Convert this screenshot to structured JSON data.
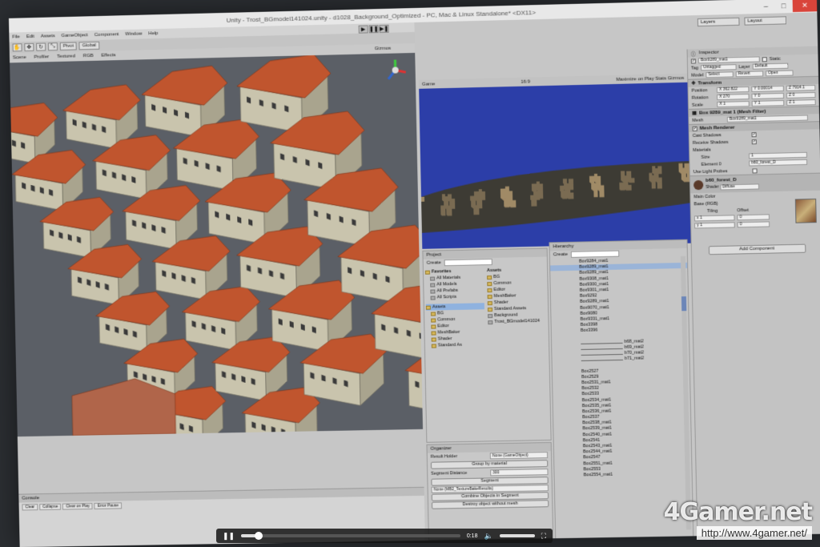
{
  "window": {
    "title": "Unity - Trost_BGmodel141024.unity - d1028_Background_Optimized - PC, Mac & Linux Standalone* <DX11>"
  },
  "menu": [
    "File",
    "Edit",
    "Assets",
    "GameObject",
    "Component",
    "Window",
    "Help"
  ],
  "toolbar": {
    "pivot_label": "Pivot",
    "global_label": "Global",
    "layers_label": "Layers",
    "layout_label": "Layout"
  },
  "scene": {
    "tabs": [
      "Scene",
      "Profiler"
    ],
    "shading": "Textured",
    "mode": "RGB",
    "effects": "Effects",
    "gizmos": "Gizmos"
  },
  "game": {
    "tab": "Game",
    "aspect": "16:9",
    "options": "Maximize on Play  Stats  Gizmos"
  },
  "project": {
    "tab": "Project",
    "create_label": "Create",
    "favorites_label": "Favorites",
    "favorites": [
      "All Materials",
      "All Models",
      "All Prefabs",
      "All Scripts"
    ],
    "assets_root": "Assets",
    "assets_tree": [
      "BG",
      "Common",
      "Editor",
      "MeshBaker",
      "Shader",
      "Standard As"
    ],
    "assets_header": "Assets",
    "assets_list": [
      "BG",
      "Common",
      "Editor",
      "MeshBaker",
      "Shader",
      "Standard Assets",
      "Background",
      "Trost_BGmodel141024"
    ]
  },
  "hierarchy": {
    "tab": "Hierarchy",
    "create_label": "Create",
    "rows": [
      {
        "label": "Box9284_mat1",
        "sel": false,
        "indent": false
      },
      {
        "label": "Box9289_mat1",
        "sel": true,
        "indent": false
      },
      {
        "label": "Box9289_mat1",
        "sel": false,
        "indent": false
      },
      {
        "label": "Box9308_mat1",
        "sel": false,
        "indent": false
      },
      {
        "label": "Box9300_mat1",
        "sel": false,
        "indent": false
      },
      {
        "label": "Box9301_mat1",
        "sel": false,
        "indent": false
      },
      {
        "label": "Box9292",
        "sel": false,
        "indent": false
      },
      {
        "label": "Box9289_mat1",
        "sel": false,
        "indent": false
      },
      {
        "label": "Box9070_mat1",
        "sel": false,
        "indent": false
      },
      {
        "label": "Box9080",
        "sel": false,
        "indent": false
      },
      {
        "label": "Box9331_mat1",
        "sel": false,
        "indent": false
      },
      {
        "label": "Box3398",
        "sel": false,
        "indent": false
      },
      {
        "label": "Box3396",
        "sel": false,
        "indent": false
      },
      {
        "label": "",
        "sel": false,
        "indent": false
      },
      {
        "label": "b68_mat2",
        "sel": false,
        "indent": true
      },
      {
        "label": "b69_mat2",
        "sel": false,
        "indent": true
      },
      {
        "label": "b70_mat2",
        "sel": false,
        "indent": true
      },
      {
        "label": "b71_mat2",
        "sel": false,
        "indent": true
      },
      {
        "label": "",
        "sel": false,
        "indent": false
      },
      {
        "label": "Box2527",
        "sel": false,
        "indent": false
      },
      {
        "label": "Box2529",
        "sel": false,
        "indent": false
      },
      {
        "label": "Box2531_mat1",
        "sel": false,
        "indent": false
      },
      {
        "label": "Box2532",
        "sel": false,
        "indent": false
      },
      {
        "label": "Box2533",
        "sel": false,
        "indent": false
      },
      {
        "label": "Box2534_mat1",
        "sel": false,
        "indent": false
      },
      {
        "label": "Box2535_mat1",
        "sel": false,
        "indent": false
      },
      {
        "label": "Box2536_mat1",
        "sel": false,
        "indent": false
      },
      {
        "label": "Box2537",
        "sel": false,
        "indent": false
      },
      {
        "label": "Box2538_mat1",
        "sel": false,
        "indent": false
      },
      {
        "label": "Box2539_mat1",
        "sel": false,
        "indent": false
      },
      {
        "label": "Box2540_mat1",
        "sel": false,
        "indent": false
      },
      {
        "label": "Box2541",
        "sel": false,
        "indent": false
      },
      {
        "label": "Box2543_mat1",
        "sel": false,
        "indent": false
      },
      {
        "label": "Box2544_mat1",
        "sel": false,
        "indent": false
      },
      {
        "label": "Box2547",
        "sel": false,
        "indent": false
      },
      {
        "label": "Box2551_mat1",
        "sel": false,
        "indent": false
      },
      {
        "label": "Box2553",
        "sel": false,
        "indent": false
      },
      {
        "label": "Box2554_mat1",
        "sel": false,
        "indent": false
      }
    ]
  },
  "organizer": {
    "tab": "Organizer",
    "result_holder_label": "Result Holder",
    "result_holder_value": "None (GameObject)",
    "group_button": "Group by material",
    "segment_distance_label": "Segment Distance",
    "segment_distance_value": "300",
    "segment_button": "Segment",
    "bake_field": "None (MB2_TextureBakeResults)",
    "combine_button": "Combine Objects in Segment",
    "destroy_button": "Destroy object without mesh"
  },
  "inspector": {
    "tab": "Inspector",
    "object_name": "Box9289_mat1",
    "static_label": "Static",
    "tag_label": "Tag",
    "tag_value": "Untagged",
    "layer_label": "Layer",
    "layer_value": "Default",
    "model_label": "Model",
    "select_label": "Select",
    "revert_label": "Revert",
    "open_label": "Open",
    "transform_label": "Transform",
    "position_label": "Position",
    "rotation_label": "Rotation",
    "scale_label": "Scale",
    "position": [
      "X 362.822",
      "Y 0.00014",
      "Z 7914.1"
    ],
    "rotation": [
      "X 270",
      "Y 0",
      "Z 0"
    ],
    "scale": [
      "X 1",
      "Y 1",
      "Z 1"
    ],
    "mesh_filter_label": "Box 9289_mat 1 (Mesh Filter)",
    "mesh_label": "Mesh",
    "mesh_value": "Box9289_mat1",
    "renderer_label": "Mesh Renderer",
    "cast_shadows": "Cast Shadows",
    "receive_shadows": "Receive Shadows",
    "materials_label": "Materials",
    "size_label": "Size",
    "size_value": "1",
    "element_label": "Element 0",
    "element_value": "b60_forest_D",
    "light_probes": "Use Light Probes",
    "material_name": "b60_forest_D",
    "shader_label": "Shader",
    "shader_value": "Diffuse",
    "main_color": "Main Color",
    "base_label": "Base (RGB)",
    "tiling_label": "Tiling",
    "offset_label": "Offset",
    "tiling": [
      "x 1",
      "y 1"
    ],
    "offset": [
      "0",
      "0"
    ],
    "add_component": "Add Component"
  },
  "console": {
    "tab": "Console",
    "buttons": [
      "Clear",
      "Collapse",
      "Clear on Play",
      "Error Pause"
    ]
  },
  "player": {
    "time": "0:18",
    "progress": 0.08,
    "volume": 1.0
  },
  "watermark": {
    "logo": "4Gamer.net",
    "url": "http://www.4gamer.net/"
  },
  "colors": {
    "game_sky": "#2c3ea8",
    "roof": "#c0552e",
    "wall": "#c9c4ad",
    "selection": "#9ab4d8"
  }
}
